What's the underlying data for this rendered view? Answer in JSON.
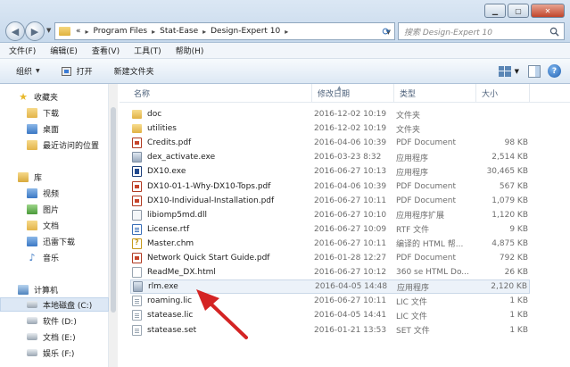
{
  "address": {
    "root_glyph": "«",
    "crumbs": [
      "Program Files",
      "Stat-Ease",
      "Design-Expert 10"
    ]
  },
  "search": {
    "placeholder": "搜索 Design-Expert 10"
  },
  "menu": [
    "文件(F)",
    "编辑(E)",
    "查看(V)",
    "工具(T)",
    "帮助(H)"
  ],
  "toolbar": {
    "organize": "组织",
    "open": "打开",
    "new_folder": "新建文件夹"
  },
  "nav": {
    "favorites": "收藏夹",
    "downloads": "下载",
    "desktop": "桌面",
    "recent": "最近访问的位置",
    "library": "库",
    "videos": "视频",
    "pictures": "图片",
    "documents": "文档",
    "thunder": "迅雷下载",
    "music": "音乐",
    "computer": "计算机",
    "drive_c": "本地磁盘 (C:)",
    "drive_d": "软件 (D:)",
    "drive_e": "文档 (E:)",
    "drive_f": "娱乐 (F:)"
  },
  "columns": {
    "name": "名称",
    "date": "修改日期",
    "type": "类型",
    "size": "大小"
  },
  "files": [
    {
      "name": "doc",
      "date": "2016-12-02 10:19",
      "type": "文件夹",
      "size": "",
      "icon": "folder"
    },
    {
      "name": "utilities",
      "date": "2016-12-02 10:19",
      "type": "文件夹",
      "size": "",
      "icon": "folder"
    },
    {
      "name": "Credits.pdf",
      "date": "2016-04-06 10:39",
      "type": "PDF Document",
      "size": "98 KB",
      "icon": "pdf"
    },
    {
      "name": "dex_activate.exe",
      "date": "2016-03-23 8:32",
      "type": "应用程序",
      "size": "2,514 KB",
      "icon": "exe"
    },
    {
      "name": "DX10.exe",
      "date": "2016-06-27 10:13",
      "type": "应用程序",
      "size": "30,465 KB",
      "icon": "dx"
    },
    {
      "name": "DX10-01-1-Why-DX10-Tops.pdf",
      "date": "2016-04-06 10:39",
      "type": "PDF Document",
      "size": "567 KB",
      "icon": "pdf"
    },
    {
      "name": "DX10-Individual-Installation.pdf",
      "date": "2016-06-27 10:11",
      "type": "PDF Document",
      "size": "1,079 KB",
      "icon": "pdf"
    },
    {
      "name": "libiomp5md.dll",
      "date": "2016-06-27 10:10",
      "type": "应用程序扩展",
      "size": "1,120 KB",
      "icon": "dll"
    },
    {
      "name": "License.rtf",
      "date": "2016-06-27 10:09",
      "type": "RTF 文件",
      "size": "9 KB",
      "icon": "rtf"
    },
    {
      "name": "Master.chm",
      "date": "2016-06-27 10:11",
      "type": "编译的 HTML 帮...",
      "size": "4,875 KB",
      "icon": "chm"
    },
    {
      "name": "Network Quick Start Guide.pdf",
      "date": "2016-01-28 12:27",
      "type": "PDF Document",
      "size": "792 KB",
      "icon": "pdf"
    },
    {
      "name": "ReadMe_DX.html",
      "date": "2016-06-27 10:12",
      "type": "360 se HTML Do...",
      "size": "26 KB",
      "icon": "html"
    },
    {
      "name": "rlm.exe",
      "date": "2016-04-05 14:48",
      "type": "应用程序",
      "size": "2,120 KB",
      "icon": "exe"
    },
    {
      "name": "roaming.lic",
      "date": "2016-06-27 10:11",
      "type": "LIC 文件",
      "size": "1 KB",
      "icon": "txt"
    },
    {
      "name": "statease.lic",
      "date": "2016-04-05 14:41",
      "type": "LIC 文件",
      "size": "1 KB",
      "icon": "txt"
    },
    {
      "name": "statease.set",
      "date": "2016-01-21 13:53",
      "type": "SET 文件",
      "size": "1 KB",
      "icon": "txt"
    }
  ],
  "selected_file_index": 12,
  "annotation_color": "#d42424"
}
